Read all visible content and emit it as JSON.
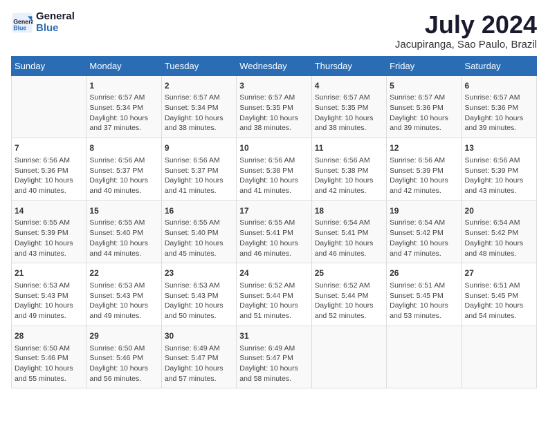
{
  "header": {
    "logo_line1": "General",
    "logo_line2": "Blue",
    "title": "July 2024",
    "subtitle": "Jacupiranga, Sao Paulo, Brazil"
  },
  "columns": [
    "Sunday",
    "Monday",
    "Tuesday",
    "Wednesday",
    "Thursday",
    "Friday",
    "Saturday"
  ],
  "weeks": [
    {
      "cells": [
        {
          "day": "",
          "info": ""
        },
        {
          "day": "1",
          "info": "Sunrise: 6:57 AM\nSunset: 5:34 PM\nDaylight: 10 hours\nand 37 minutes."
        },
        {
          "day": "2",
          "info": "Sunrise: 6:57 AM\nSunset: 5:34 PM\nDaylight: 10 hours\nand 38 minutes."
        },
        {
          "day": "3",
          "info": "Sunrise: 6:57 AM\nSunset: 5:35 PM\nDaylight: 10 hours\nand 38 minutes."
        },
        {
          "day": "4",
          "info": "Sunrise: 6:57 AM\nSunset: 5:35 PM\nDaylight: 10 hours\nand 38 minutes."
        },
        {
          "day": "5",
          "info": "Sunrise: 6:57 AM\nSunset: 5:36 PM\nDaylight: 10 hours\nand 39 minutes."
        },
        {
          "day": "6",
          "info": "Sunrise: 6:57 AM\nSunset: 5:36 PM\nDaylight: 10 hours\nand 39 minutes."
        }
      ]
    },
    {
      "cells": [
        {
          "day": "7",
          "info": "Sunrise: 6:56 AM\nSunset: 5:36 PM\nDaylight: 10 hours\nand 40 minutes."
        },
        {
          "day": "8",
          "info": "Sunrise: 6:56 AM\nSunset: 5:37 PM\nDaylight: 10 hours\nand 40 minutes."
        },
        {
          "day": "9",
          "info": "Sunrise: 6:56 AM\nSunset: 5:37 PM\nDaylight: 10 hours\nand 41 minutes."
        },
        {
          "day": "10",
          "info": "Sunrise: 6:56 AM\nSunset: 5:38 PM\nDaylight: 10 hours\nand 41 minutes."
        },
        {
          "day": "11",
          "info": "Sunrise: 6:56 AM\nSunset: 5:38 PM\nDaylight: 10 hours\nand 42 minutes."
        },
        {
          "day": "12",
          "info": "Sunrise: 6:56 AM\nSunset: 5:39 PM\nDaylight: 10 hours\nand 42 minutes."
        },
        {
          "day": "13",
          "info": "Sunrise: 6:56 AM\nSunset: 5:39 PM\nDaylight: 10 hours\nand 43 minutes."
        }
      ]
    },
    {
      "cells": [
        {
          "day": "14",
          "info": "Sunrise: 6:55 AM\nSunset: 5:39 PM\nDaylight: 10 hours\nand 43 minutes."
        },
        {
          "day": "15",
          "info": "Sunrise: 6:55 AM\nSunset: 5:40 PM\nDaylight: 10 hours\nand 44 minutes."
        },
        {
          "day": "16",
          "info": "Sunrise: 6:55 AM\nSunset: 5:40 PM\nDaylight: 10 hours\nand 45 minutes."
        },
        {
          "day": "17",
          "info": "Sunrise: 6:55 AM\nSunset: 5:41 PM\nDaylight: 10 hours\nand 46 minutes."
        },
        {
          "day": "18",
          "info": "Sunrise: 6:54 AM\nSunset: 5:41 PM\nDaylight: 10 hours\nand 46 minutes."
        },
        {
          "day": "19",
          "info": "Sunrise: 6:54 AM\nSunset: 5:42 PM\nDaylight: 10 hours\nand 47 minutes."
        },
        {
          "day": "20",
          "info": "Sunrise: 6:54 AM\nSunset: 5:42 PM\nDaylight: 10 hours\nand 48 minutes."
        }
      ]
    },
    {
      "cells": [
        {
          "day": "21",
          "info": "Sunrise: 6:53 AM\nSunset: 5:43 PM\nDaylight: 10 hours\nand 49 minutes."
        },
        {
          "day": "22",
          "info": "Sunrise: 6:53 AM\nSunset: 5:43 PM\nDaylight: 10 hours\nand 49 minutes."
        },
        {
          "day": "23",
          "info": "Sunrise: 6:53 AM\nSunset: 5:43 PM\nDaylight: 10 hours\nand 50 minutes."
        },
        {
          "day": "24",
          "info": "Sunrise: 6:52 AM\nSunset: 5:44 PM\nDaylight: 10 hours\nand 51 minutes."
        },
        {
          "day": "25",
          "info": "Sunrise: 6:52 AM\nSunset: 5:44 PM\nDaylight: 10 hours\nand 52 minutes."
        },
        {
          "day": "26",
          "info": "Sunrise: 6:51 AM\nSunset: 5:45 PM\nDaylight: 10 hours\nand 53 minutes."
        },
        {
          "day": "27",
          "info": "Sunrise: 6:51 AM\nSunset: 5:45 PM\nDaylight: 10 hours\nand 54 minutes."
        }
      ]
    },
    {
      "cells": [
        {
          "day": "28",
          "info": "Sunrise: 6:50 AM\nSunset: 5:46 PM\nDaylight: 10 hours\nand 55 minutes."
        },
        {
          "day": "29",
          "info": "Sunrise: 6:50 AM\nSunset: 5:46 PM\nDaylight: 10 hours\nand 56 minutes."
        },
        {
          "day": "30",
          "info": "Sunrise: 6:49 AM\nSunset: 5:47 PM\nDaylight: 10 hours\nand 57 minutes."
        },
        {
          "day": "31",
          "info": "Sunrise: 6:49 AM\nSunset: 5:47 PM\nDaylight: 10 hours\nand 58 minutes."
        },
        {
          "day": "",
          "info": ""
        },
        {
          "day": "",
          "info": ""
        },
        {
          "day": "",
          "info": ""
        }
      ]
    }
  ]
}
